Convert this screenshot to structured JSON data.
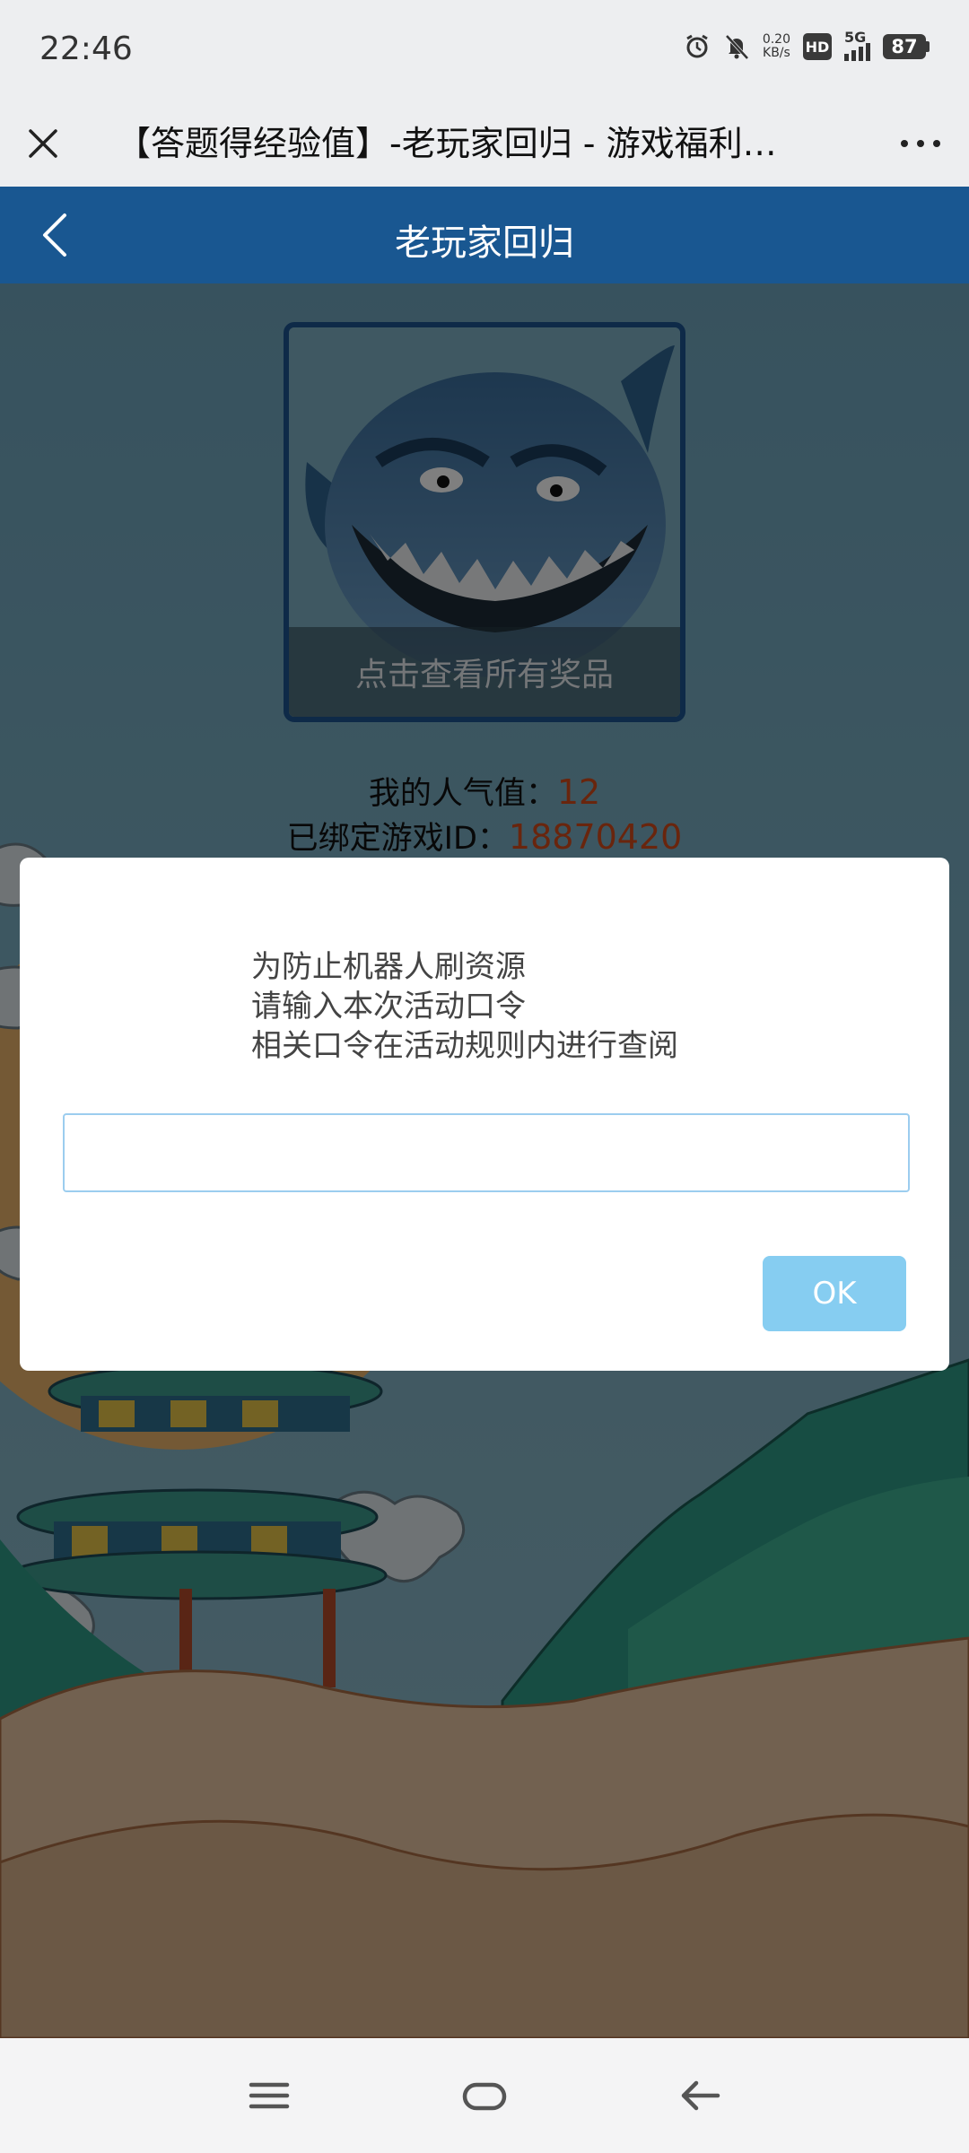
{
  "status_bar": {
    "time": "22:46",
    "net_speed_value": "0.20",
    "net_speed_unit": "KB/s",
    "hd_label": "HD",
    "network_label": "5G",
    "battery": "87"
  },
  "title_bar": {
    "title": "【答题得经验值】-老玩家回归 - 游戏福利…"
  },
  "header": {
    "title": "老玩家回归"
  },
  "avatar": {
    "caption": "点击查看所有奖品"
  },
  "stats": {
    "popularity_label": "我的人气值：",
    "popularity_value": "12",
    "game_id_label": "已绑定游戏ID：",
    "game_id_value": "18870420"
  },
  "dialog": {
    "line1": "为防止机器人刷资源",
    "line2": "请输入本次活动口令",
    "line3": "相关口令在活动规则内进行查阅",
    "input_value": "",
    "ok_label": "OK"
  },
  "colors": {
    "header_bg": "#195791",
    "accent_value": "#d34a1a",
    "ok_button": "#86cdf1",
    "input_border": "#9ccdef"
  }
}
